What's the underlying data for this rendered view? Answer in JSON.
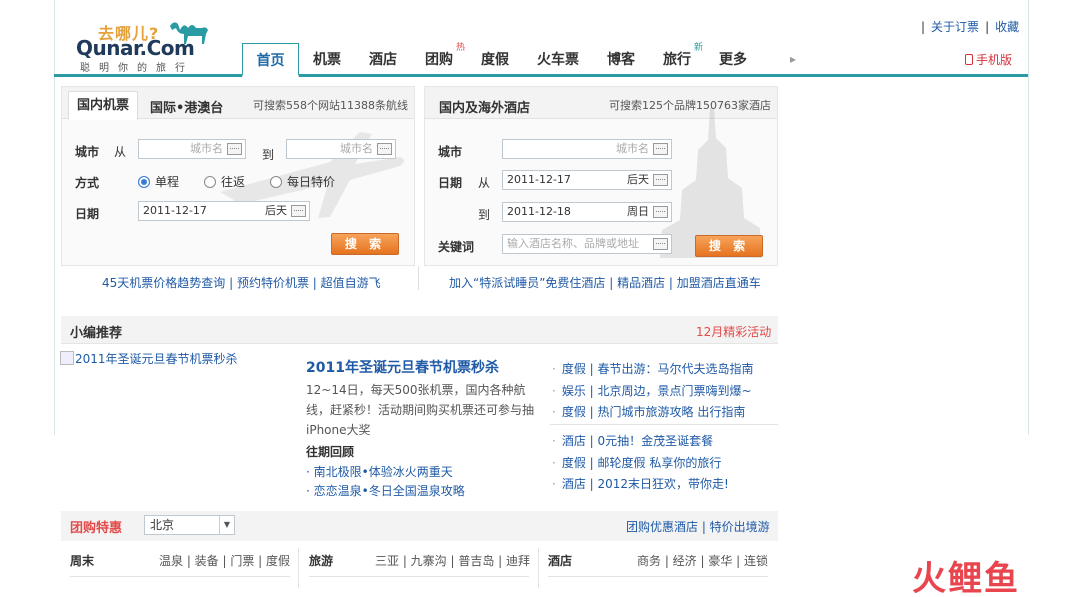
{
  "header": {
    "logo_cn": "去哪儿?",
    "logo_en": "Qunar.Com",
    "logo_slogan": "聪明你的旅行",
    "top_links": [
      "关于订票",
      "收藏"
    ],
    "mobile_label": "手机版",
    "nav": [
      {
        "label": "首页",
        "active": true,
        "badge": ""
      },
      {
        "label": "机票",
        "badge": ""
      },
      {
        "label": "酒店",
        "badge": ""
      },
      {
        "label": "团购",
        "badge": "热"
      },
      {
        "label": "度假",
        "badge": ""
      },
      {
        "label": "火车票",
        "badge": ""
      },
      {
        "label": "博客",
        "badge": ""
      },
      {
        "label": "旅行",
        "badge": "新"
      },
      {
        "label": "更多",
        "badge": ""
      }
    ],
    "nav_arrow": "▸"
  },
  "flight": {
    "tab_domestic": "国内机票",
    "tab_intl": "国际•港澳台",
    "note": "可搜索558个网站11388条航线",
    "city_label": "城市",
    "from_label": "从",
    "to_label": "到",
    "city_placeholder": "城市名",
    "mode_label": "方式",
    "modes": [
      "单程",
      "往返",
      "每日特价"
    ],
    "date_label": "日期",
    "date_value": "2011-12-17",
    "date_suffix": "后天",
    "search_label": "搜 索",
    "links": "45天机票价格趋势查询 | 预约特价机票 | 超值自游飞"
  },
  "hotel": {
    "tab": "国内及海外酒店",
    "note": "可搜索125个品牌150763家酒店",
    "city_label": "城市",
    "city_placeholder": "城市名",
    "date_label": "日期",
    "from_label": "从",
    "to_label": "到",
    "checkin": "2011-12-17",
    "checkin_suffix": "后天",
    "checkout": "2011-12-18",
    "checkout_suffix": "周日",
    "keyword_label": "关键词",
    "keyword_placeholder": "输入酒店名称、品牌或地址",
    "search_label": "搜 索",
    "links": "加入“特派试睡员”免费住酒店 | 精品酒店 | 加盟酒店直通车"
  },
  "recommend": {
    "title": "小编推荐",
    "right_link": "12月精彩活动",
    "image_alt": "2011年圣诞元旦春节机票秒杀",
    "headline": "2011年圣诞元旦春节机票秒杀",
    "desc": "12~14日，每天500张机票，国内各种航线，赶紧秒！活动期间购买机票还可参与抽iPhone大奖",
    "past_title": "往期回顾",
    "past_items": [
      "南北极限•体验冰火两重天",
      "恋恋温泉•冬日全国温泉攻略"
    ],
    "side_items_top": [
      "度假 | 春节出游：马尔代夫选岛指南",
      "娱乐 | 北京周边，景点门票嗨到爆~",
      "度假 | 热门城市旅游攻略 出行指南"
    ],
    "side_items_bottom": [
      "酒店 | 0元抽！金茂圣诞套餐",
      "度假 | 邮轮度假 私享你的旅行",
      "酒店 | 2012末日狂欢，带你走!"
    ]
  },
  "groupbuy": {
    "title": "团购特惠",
    "city": "北京",
    "right_links": "团购优惠酒店 | 特价出境游",
    "categories": [
      {
        "title": "周末",
        "links": "温泉 | 装备 | 门票 | 度假"
      },
      {
        "title": "旅游",
        "links": "三亚 | 九寨沟 | 普吉岛 | 迪拜"
      },
      {
        "title": "酒店",
        "links": "商务 | 经济 | 豪华 | 连锁"
      }
    ]
  },
  "watermark": "火鲤鱼",
  "colors": {
    "accent": "#2a9aa3",
    "link": "#1f5aa6",
    "red": "#e34a4a",
    "button": "#e5731f"
  }
}
